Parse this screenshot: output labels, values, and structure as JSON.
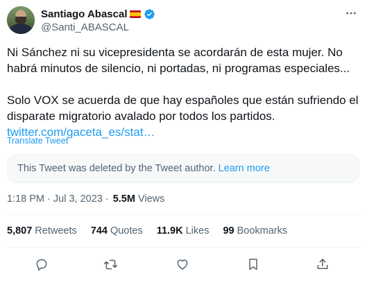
{
  "author": {
    "display_name": "Santiago Abascal",
    "handle": "@Santi_ABASCAL",
    "flag_icon": "spain-flag-icon",
    "verified_icon": "verified-badge-icon",
    "verified_color": "#1d9bf0"
  },
  "tweet": {
    "paragraph1": "Ni Sánchez ni su vicepresidenta se acordarán de esta mujer. No habrá minutos de silencio, ni portadas, ni programas especiales...",
    "paragraph2": "Solo VOX se acuerda de que hay españoles que están sufriendo el disparate migratorio avalado por todos los partidos.",
    "link": "twitter.com/gaceta_es/stat…",
    "translate_label": "Translate Tweet"
  },
  "quoted": {
    "deleted_text": "This Tweet was deleted by the Tweet author.",
    "learn_more": "Learn more"
  },
  "meta": {
    "timestamp": "1:18 PM · Jul 3, 2023 · ",
    "views_count": "5.5M",
    "views_label": "Views"
  },
  "stats": [
    {
      "count": "5,807",
      "label": "Retweets"
    },
    {
      "count": "744",
      "label": "Quotes"
    },
    {
      "count": "11.9K",
      "label": "Likes"
    },
    {
      "count": "99",
      "label": "Bookmarks"
    }
  ],
  "actions": [
    "reply-icon",
    "retweet-icon",
    "like-icon",
    "bookmark-icon",
    "share-icon"
  ],
  "colors": {
    "text": "#0f1419",
    "secondary": "#536471",
    "accent": "#1d9bf0",
    "divider": "#eff3f4"
  }
}
